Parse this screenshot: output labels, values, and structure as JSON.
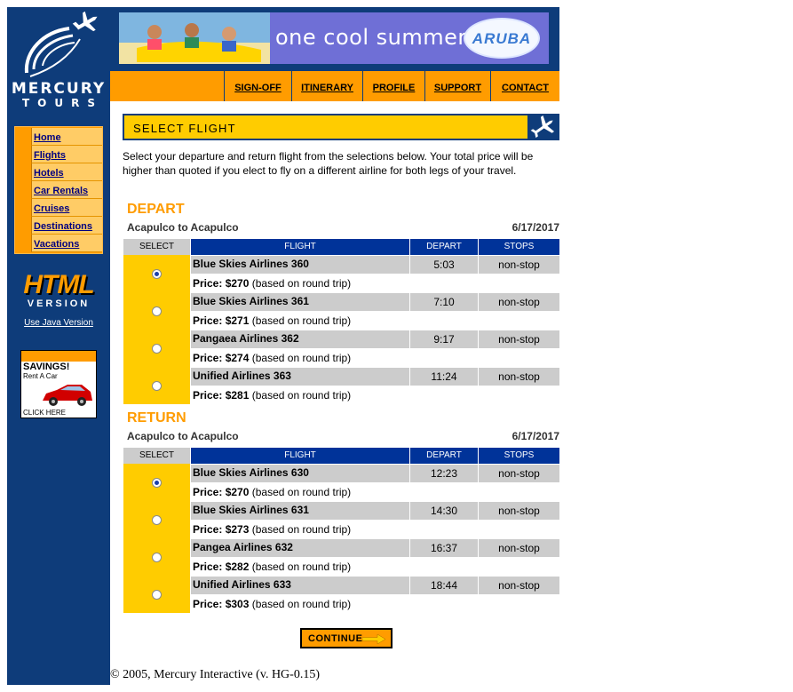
{
  "brand": {
    "name": "MERCURY",
    "subname": "TOURS"
  },
  "sidebar": {
    "nav": [
      "Home",
      "Flights",
      "Hotels",
      "Car Rentals",
      "Cruises",
      "Destinations",
      "Vacations"
    ],
    "html_badge": {
      "title": "HTML",
      "subtitle": "VERSION"
    },
    "java_link": "Use Java Version",
    "ad": {
      "title": "SAVINGS!",
      "sub": "Rent A Car",
      "cta": "CLICK HERE"
    }
  },
  "banner": {
    "text": "one cool summer",
    "logo": "ARUBA"
  },
  "topnav": [
    "SIGN-OFF",
    "ITINERARY",
    "PROFILE",
    "SUPPORT",
    "CONTACT"
  ],
  "page": {
    "title": "SELECT FLIGHT",
    "intro": "Select your departure and return flight from the selections below. Your total price will be higher than quoted if you elect to fly on a different airline for both legs of your travel."
  },
  "table_headers": {
    "select": "SELECT",
    "flight": "FLIGHT",
    "depart": "DEPART",
    "stops": "STOPS"
  },
  "price_label": "Price:",
  "price_note": "(based on round trip)",
  "depart": {
    "title": "DEPART",
    "route": "Acapulco to Acapulco",
    "date": "6/17/2017",
    "flights": [
      {
        "name": "Blue Skies Airlines 360",
        "time": "5:03",
        "stops": "non-stop",
        "price": "$270",
        "selected": true
      },
      {
        "name": "Blue Skies Airlines 361",
        "time": "7:10",
        "stops": "non-stop",
        "price": "$271",
        "selected": false
      },
      {
        "name": "Pangaea Airlines 362",
        "time": "9:17",
        "stops": "non-stop",
        "price": "$274",
        "selected": false
      },
      {
        "name": "Unified Airlines 363",
        "time": "11:24",
        "stops": "non-stop",
        "price": "$281",
        "selected": false
      }
    ]
  },
  "return": {
    "title": "RETURN",
    "route": "Acapulco to Acapulco",
    "date": "6/17/2017",
    "flights": [
      {
        "name": "Blue Skies Airlines 630",
        "time": "12:23",
        "stops": "non-stop",
        "price": "$270",
        "selected": true
      },
      {
        "name": "Blue Skies Airlines 631",
        "time": "14:30",
        "stops": "non-stop",
        "price": "$273",
        "selected": false
      },
      {
        "name": "Pangea Airlines 632",
        "time": "16:37",
        "stops": "non-stop",
        "price": "$282",
        "selected": false
      },
      {
        "name": "Unified Airlines 633",
        "time": "18:44",
        "stops": "non-stop",
        "price": "$303",
        "selected": false
      }
    ]
  },
  "continue_label": "CONTINUE",
  "footer": "© 2005, Mercury Interactive (v. HG-0.15)",
  "colors": {
    "navy": "#0e3c7a",
    "orange": "#ff9c00",
    "yellow": "#ffcc00",
    "header_blue": "#003399"
  }
}
